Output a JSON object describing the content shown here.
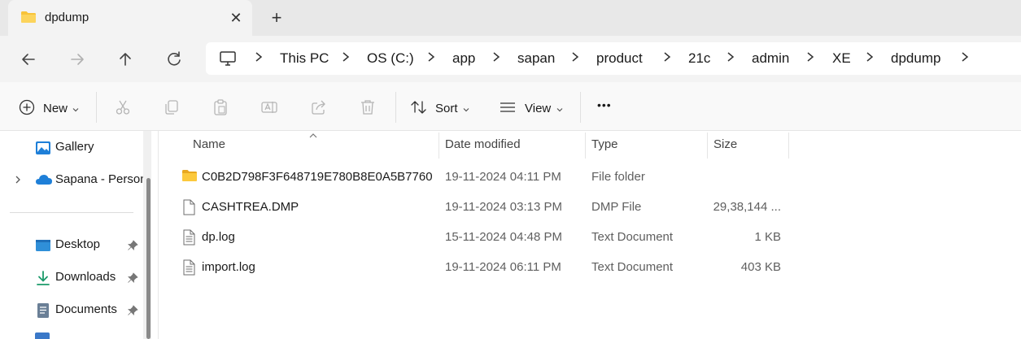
{
  "tab": {
    "title": "dpdump",
    "close_glyph": "✕",
    "new_tab_glyph": "+",
    "icon": "folder-icon"
  },
  "navigation": {
    "back_icon": "arrow-left-icon",
    "forward_icon": "arrow-right-icon",
    "up_icon": "arrow-up-icon",
    "refresh_icon": "refresh-icon"
  },
  "address": {
    "root_icon": "computer-icon",
    "crumbs": [
      "This PC",
      "OS (C:)",
      "app",
      "sapan",
      "product",
      "21c",
      "admin",
      "XE",
      "dpdump"
    ]
  },
  "commands": {
    "new_label": "New",
    "sort_label": "Sort",
    "view_label": "View",
    "more_glyph": "•••",
    "icons": [
      "cut-icon",
      "copy-icon",
      "paste-icon",
      "rename-icon",
      "share-icon",
      "delete-icon"
    ]
  },
  "sidebar": {
    "items": [
      {
        "label": "Gallery",
        "icon": "gallery-icon"
      },
      {
        "label": "Sapana - Person",
        "icon": "onedrive-icon"
      },
      {
        "label": "Desktop",
        "icon": "desktop-icon",
        "pinned": true
      },
      {
        "label": "Downloads",
        "icon": "download-icon",
        "pinned": true
      },
      {
        "label": "Documents",
        "icon": "documents-icon",
        "pinned": true
      }
    ]
  },
  "table": {
    "columns": [
      "Name",
      "Date modified",
      "Type",
      "Size"
    ],
    "rows": [
      {
        "name": "C0B2D798F3F648719E780B8E0A5B7760",
        "date": "19-11-2024 04:11 PM",
        "type": "File folder",
        "size": "",
        "icon": "folder-icon"
      },
      {
        "name": "CASHTREA.DMP",
        "date": "19-11-2024 03:13 PM",
        "type": "DMP File",
        "size": "29,38,144 ...",
        "icon": "file-icon"
      },
      {
        "name": "dp.log",
        "date": "15-11-2024 04:48 PM",
        "type": "Text Document",
        "size": "1 KB",
        "icon": "text-file-icon"
      },
      {
        "name": "import.log",
        "date": "19-11-2024 06:11 PM",
        "type": "Text Document",
        "size": "403 KB",
        "icon": "text-file-icon"
      }
    ]
  },
  "colors": {
    "folder": "#f8c33a",
    "accent": "#0067c0",
    "onedrive": "#1e7fd8"
  }
}
